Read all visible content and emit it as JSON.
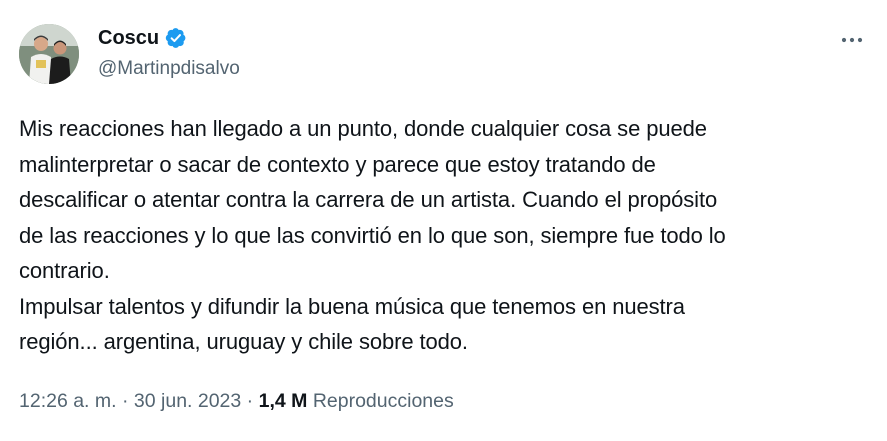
{
  "author": {
    "display_name": "Coscu",
    "handle": "@Martinpdisalvo",
    "verified": true,
    "avatar_icon": "profile-photo"
  },
  "colors": {
    "verified_blue": "#1d9bf0",
    "text_primary": "#0f1419",
    "text_secondary": "#536471"
  },
  "tweet": {
    "text": "Mis reacciones han llegado a un punto, donde cualquier cosa se puede\nmalinterpretar o sacar de contexto y parece que estoy tratando de\ndescalificar o atentar contra la carrera de un artista. Cuando el propósito\nde las reacciones y lo que las convirtió en lo que son, siempre fue todo lo\ncontrario.\nImpulsar talentos y difundir la buena música que tenemos en nuestra\nregión... argentina, uruguay y chile sobre todo."
  },
  "meta": {
    "time": "12:26 a. m.",
    "separator": " · ",
    "date": "30 jun. 2023",
    "views_count": "1,4 M",
    "views_label": "Reproducciones"
  },
  "icons": {
    "more": "more-horizontal-icon",
    "verified": "verified-badge-icon"
  }
}
